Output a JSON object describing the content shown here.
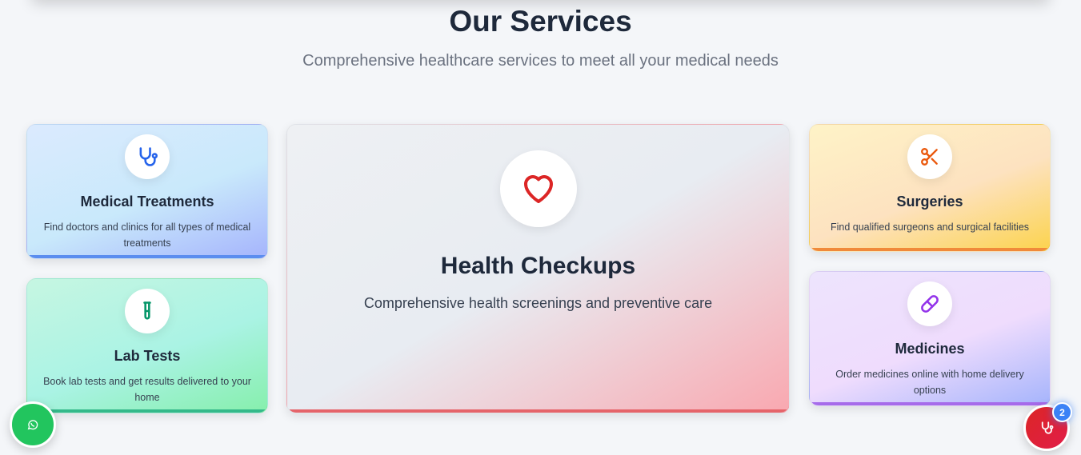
{
  "header": {
    "title": "Our Services",
    "subtitle": "Comprehensive healthcare services to meet all your medical needs"
  },
  "services": [
    {
      "title": "Medical Treatments",
      "description": "Find doctors and clinics for all types of medical treatments",
      "icon": "stethoscope-icon",
      "color": "#2563eb"
    },
    {
      "title": "Lab Tests",
      "description": "Book lab tests and get results delivered to your home",
      "icon": "test-tube-icon",
      "color": "#059669"
    },
    {
      "title": "Health Checkups",
      "description": "Comprehensive health screenings and preventive care",
      "icon": "heart-icon",
      "color": "#dc2626"
    },
    {
      "title": "Surgeries",
      "description": "Find qualified surgeons and surgical facilities",
      "icon": "scissors-icon",
      "color": "#ea580c"
    },
    {
      "title": "Medicines",
      "description": "Order medicines online with home delivery options",
      "icon": "pill-icon",
      "color": "#9333ea"
    }
  ],
  "floating": {
    "whatsapp_icon": "whatsapp-icon",
    "consult_icon": "stethoscope-icon",
    "consult_badge": "2"
  }
}
